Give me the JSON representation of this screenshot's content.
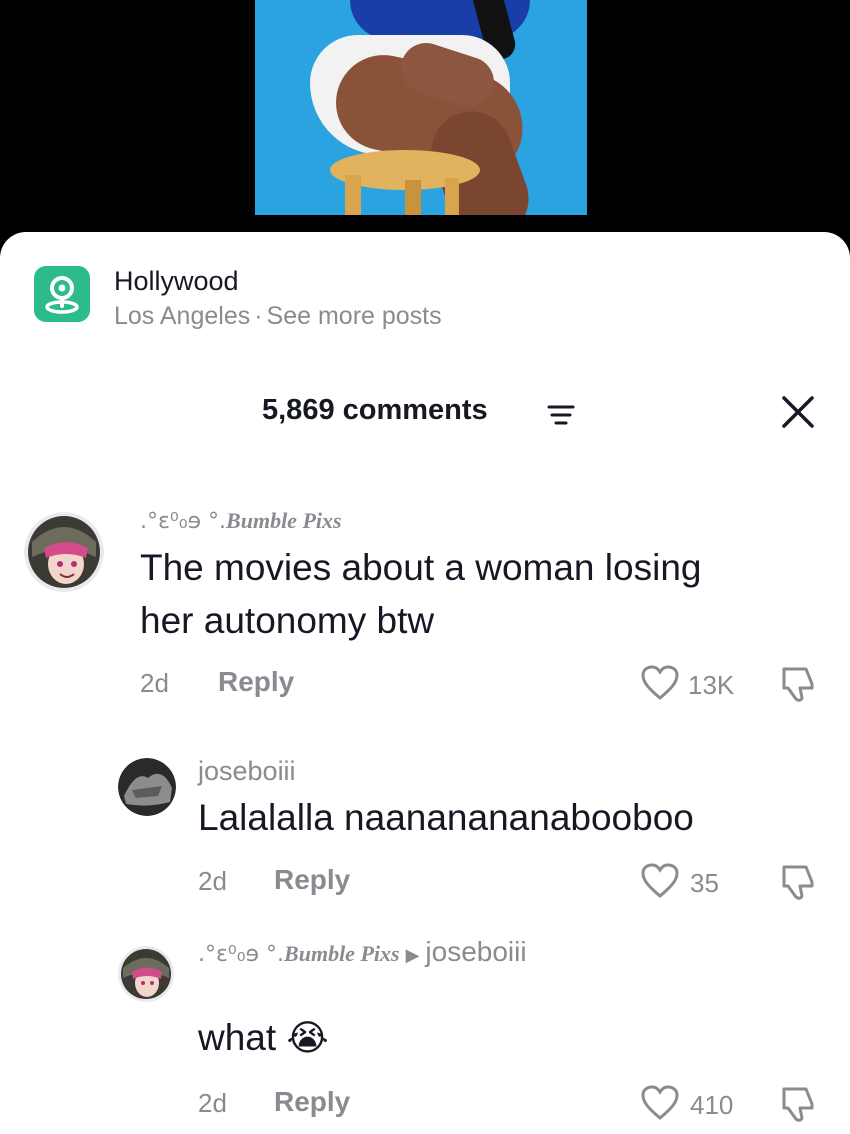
{
  "location": {
    "name": "Hollywood",
    "city": "Los Angeles",
    "separator": "·",
    "link": "See more posts"
  },
  "comments_header": {
    "count_label": "5,869 comments"
  },
  "comments": [
    {
      "username_deco": ".°ɛ⁰₀ɘ °.",
      "username": "Bumble Pixs",
      "text_line1": "The movies about a woman losing",
      "text_line2": "her autonomy btw",
      "time": "2d",
      "reply_label": "Reply",
      "likes": "13K"
    },
    {
      "username": "joseboiii",
      "text": "Lalalalla naananananabooboo",
      "time": "2d",
      "reply_label": "Reply",
      "likes": "35"
    },
    {
      "username_deco": ".°ɛ⁰₀ɘ °.",
      "username": "Bumble Pixs",
      "reply_to": "joseboiii",
      "text": "what",
      "emoji": "😭",
      "time": "2d",
      "reply_label": "Reply",
      "likes": "410"
    }
  ],
  "colors": {
    "location_icon": "#2dba8d",
    "video_bg": "#2aa3e0",
    "secondary_text": "#8a8b91"
  }
}
